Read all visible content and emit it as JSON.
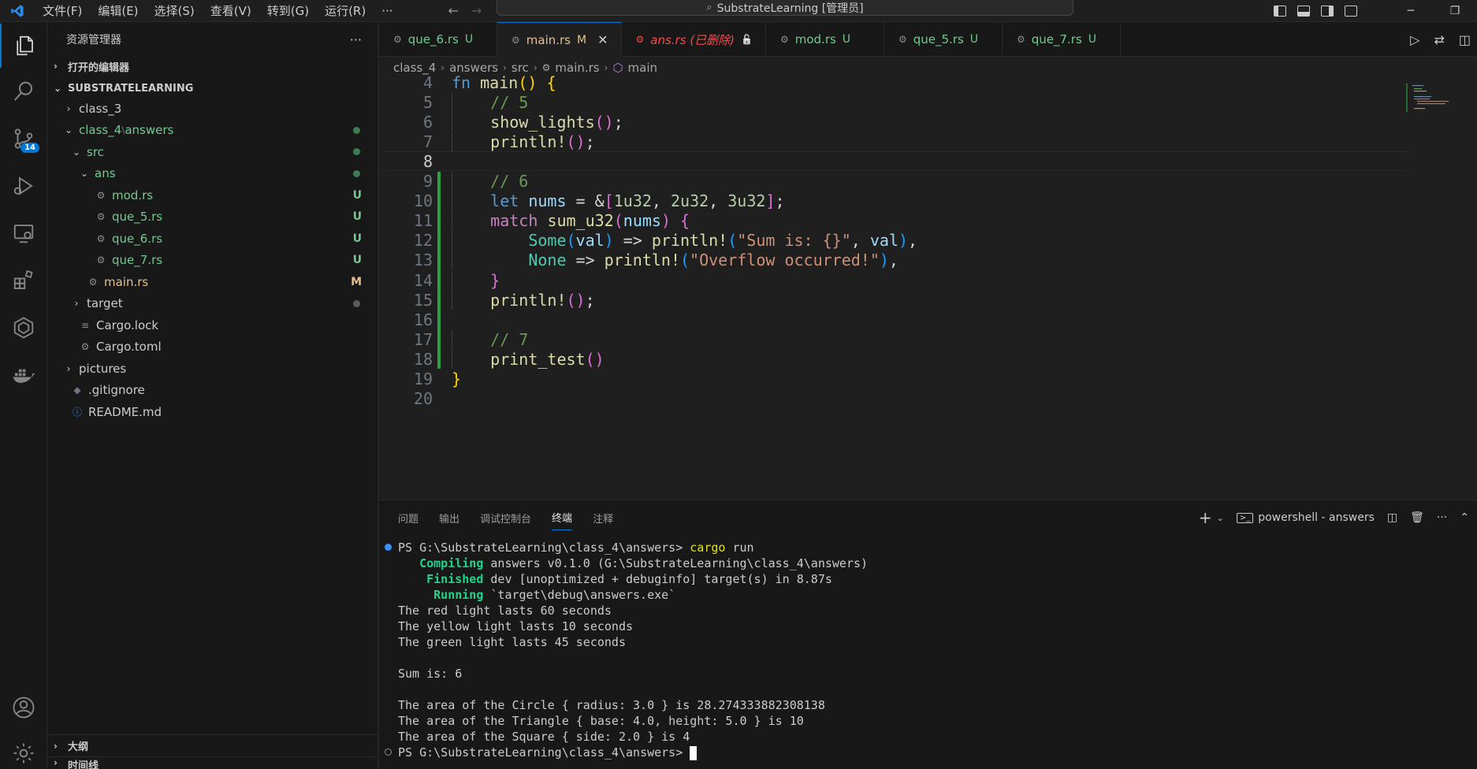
{
  "titlebar": {
    "menus": [
      "文件(F)",
      "编辑(E)",
      "选择(S)",
      "查看(V)",
      "转到(G)",
      "运行(R)",
      "···"
    ],
    "search_text": "SubstrateLearning [管理员]"
  },
  "activity": {
    "source_control_badge": "14"
  },
  "sidebar": {
    "title": "资源管理器",
    "more": "···",
    "open_editors": "打开的编辑器",
    "workspace": "SUBSTRATELEARNING",
    "tree": [
      {
        "label": "class_3",
        "indent": 1,
        "chev": "›",
        "kind": "folder",
        "color": "normal",
        "status": ""
      },
      {
        "label": "class_4",
        "label2": "answers",
        "indent": 1,
        "chev": "⌄",
        "kind": "folder",
        "color": "git",
        "status": "dot"
      },
      {
        "label": "src",
        "indent": 2,
        "chev": "⌄",
        "kind": "folder",
        "color": "git",
        "status": "dot"
      },
      {
        "label": "ans",
        "indent": 3,
        "chev": "⌄",
        "kind": "folder",
        "color": "git",
        "status": "dot"
      },
      {
        "label": "mod.rs",
        "indent": 4,
        "chev": "",
        "kind": "rust",
        "color": "git",
        "status": "U"
      },
      {
        "label": "que_5.rs",
        "indent": 4,
        "chev": "",
        "kind": "rust",
        "color": "git",
        "status": "U"
      },
      {
        "label": "que_6.rs",
        "indent": 4,
        "chev": "",
        "kind": "rust",
        "color": "git",
        "status": "U"
      },
      {
        "label": "que_7.rs",
        "indent": 4,
        "chev": "",
        "kind": "rust",
        "color": "git",
        "status": "U"
      },
      {
        "label": "main.rs",
        "indent": 3,
        "chev": "",
        "kind": "rust",
        "color": "mod",
        "status": "M"
      },
      {
        "label": "target",
        "indent": 2,
        "chev": "›",
        "kind": "folder",
        "color": "normal",
        "status": "graydot"
      },
      {
        "label": "Cargo.lock",
        "indent": 2,
        "chev": "",
        "kind": "lock",
        "color": "normal",
        "status": ""
      },
      {
        "label": "Cargo.toml",
        "indent": 2,
        "chev": "",
        "kind": "gear",
        "color": "normal",
        "status": ""
      },
      {
        "label": "pictures",
        "indent": 1,
        "chev": "›",
        "kind": "folder",
        "color": "normal",
        "status": ""
      },
      {
        "label": ".gitignore",
        "indent": 1,
        "chev": "",
        "kind": "git",
        "color": "normal",
        "status": ""
      },
      {
        "label": "README.md",
        "indent": 1,
        "chev": "",
        "kind": "info",
        "color": "normal",
        "status": ""
      }
    ],
    "outline": "大纲",
    "timeline": "时间线"
  },
  "tabs": [
    {
      "name": "que_6.rs",
      "mark": "U",
      "state": "normal"
    },
    {
      "name": "main.rs",
      "mark": "M",
      "state": "active"
    },
    {
      "name": "ans.rs (已删除)",
      "mark": "",
      "state": "deleted"
    },
    {
      "name": "mod.rs",
      "mark": "U",
      "state": "normal"
    },
    {
      "name": "que_5.rs",
      "mark": "U",
      "state": "normal"
    },
    {
      "name": "que_7.rs",
      "mark": "U",
      "state": "normal"
    }
  ],
  "breadcrumb": [
    "class_4",
    "answers",
    "src",
    "main.rs",
    "main"
  ],
  "code": [
    {
      "n": "4",
      "html": "<span class=\"kw\">fn</span> <span class=\"fn\">main</span><span class=\"br1\">()</span> <span class=\"br1\">{</span>"
    },
    {
      "n": "5",
      "html": "    <span class=\"cm\">// 5</span>"
    },
    {
      "n": "6",
      "html": "    <span class=\"fn\">show_lights</span><span class=\"br2\">()</span>;"
    },
    {
      "n": "7",
      "html": "    <span class=\"fn\">println!</span><span class=\"br2\">()</span>;"
    },
    {
      "n": "8",
      "html": ""
    },
    {
      "n": "9",
      "html": "    <span class=\"cm\">// 6</span>"
    },
    {
      "n": "10",
      "html": "    <span class=\"kw\">let</span> <span class=\"var\">nums</span> = &amp;<span class=\"br2\">[</span><span class=\"num\">1u32</span>, <span class=\"num\">2u32</span>, <span class=\"num\">3u32</span><span class=\"br2\">]</span>;"
    },
    {
      "n": "11",
      "html": "    <span class=\"kw2\">match</span> <span class=\"fn\">sum_u32</span><span class=\"br2\">(</span><span class=\"var\">nums</span><span class=\"br2\">)</span> <span class=\"br2\">{</span>"
    },
    {
      "n": "12",
      "html": "        <span class=\"ty\">Some</span><span class=\"br3\">(</span><span class=\"var\">val</span><span class=\"br3\">)</span> =&gt; <span class=\"fn\">println!</span><span class=\"br3\">(</span><span class=\"str\">\"Sum is: {}\"</span>, <span class=\"var\">val</span><span class=\"br3\">)</span>,"
    },
    {
      "n": "13",
      "html": "        <span class=\"ty\">None</span> =&gt; <span class=\"fn\">println!</span><span class=\"br3\">(</span><span class=\"str\">\"Overflow occurred!\"</span><span class=\"br3\">)</span>,"
    },
    {
      "n": "14",
      "html": "    <span class=\"br2\">}</span>"
    },
    {
      "n": "15",
      "html": "    <span class=\"fn\">println!</span><span class=\"br2\">()</span>;"
    },
    {
      "n": "16",
      "html": ""
    },
    {
      "n": "17",
      "html": "    <span class=\"cm\">// 7</span>"
    },
    {
      "n": "18",
      "html": "    <span class=\"fn\">print_test</span><span class=\"br2\">()</span>"
    },
    {
      "n": "19",
      "html": "<span class=\"br1\">}</span>"
    },
    {
      "n": "20",
      "html": ""
    }
  ],
  "panel": {
    "tabs": [
      "问题",
      "输出",
      "调试控制台",
      "终端",
      "注释"
    ],
    "active_tab": "终端",
    "shell_label": "powershell - answers"
  },
  "terminal": [
    {
      "dot": "blue",
      "html": "PS G:\\SubstrateLearning\\class_4\\answers&gt; <span class=\"ty2\">cargo</span> run"
    },
    {
      "dot": "",
      "html": "   <span class=\"tg\">Compiling</span> answers v0.1.0 (G:\\SubstrateLearning\\class_4\\answers)"
    },
    {
      "dot": "",
      "html": "    <span class=\"tg\">Finished</span> dev [unoptimized + debuginfo] target(s) in 8.87s"
    },
    {
      "dot": "",
      "html": "     <span class=\"tg\">Running</span> `target\\debug\\answers.exe`"
    },
    {
      "dot": "",
      "html": "The red light lasts 60 seconds"
    },
    {
      "dot": "",
      "html": "The yellow light lasts 10 seconds"
    },
    {
      "dot": "",
      "html": "The green light lasts 45 seconds"
    },
    {
      "dot": "",
      "html": ""
    },
    {
      "dot": "",
      "html": "Sum is: 6"
    },
    {
      "dot": "",
      "html": ""
    },
    {
      "dot": "",
      "html": "The area of the Circle { radius: 3.0 } is 28.274333882308138"
    },
    {
      "dot": "",
      "html": "The area of the Triangle { base: 4.0, height: 5.0 } is 10"
    },
    {
      "dot": "",
      "html": "The area of the Square { side: 2.0 } is 4"
    },
    {
      "dot": "gray",
      "html": "PS G:\\SubstrateLearning\\class_4\\answers&gt; <span class=\"cursor\"></span>"
    }
  ],
  "colors": {
    "accent": "#0078d4",
    "git_untracked": "#73c991",
    "git_modified": "#e2c08d",
    "deleted": "#f14c4c"
  }
}
